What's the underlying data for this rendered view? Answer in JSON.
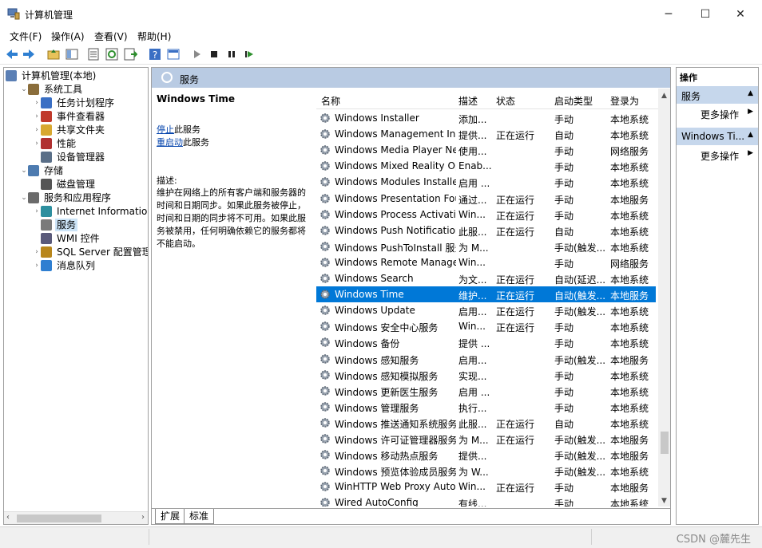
{
  "window": {
    "title": "计算机管理",
    "minimize": "─",
    "maximize": "☐",
    "close": "✕"
  },
  "menu": [
    "文件(F)",
    "操作(A)",
    "查看(V)",
    "帮助(H)"
  ],
  "tree": [
    {
      "label": "计算机管理(本地)",
      "icon": "computer-icon",
      "level": 0,
      "arrow": ""
    },
    {
      "label": "系统工具",
      "icon": "tools-icon",
      "level": 1,
      "arrow": "⌄"
    },
    {
      "label": "任务计划程序",
      "icon": "clock-icon",
      "level": 2,
      "arrow": "›"
    },
    {
      "label": "事件查看器",
      "icon": "event-viewer-icon",
      "level": 2,
      "arrow": "›"
    },
    {
      "label": "共享文件夹",
      "icon": "shared-folder-icon",
      "level": 2,
      "arrow": "›"
    },
    {
      "label": "性能",
      "icon": "performance-icon",
      "level": 2,
      "arrow": "›"
    },
    {
      "label": "设备管理器",
      "icon": "device-manager-icon",
      "level": 2,
      "arrow": ""
    },
    {
      "label": "存储",
      "icon": "storage-icon",
      "level": 1,
      "arrow": "⌄"
    },
    {
      "label": "磁盘管理",
      "icon": "disk-icon",
      "level": 2,
      "arrow": ""
    },
    {
      "label": "服务和应用程序",
      "icon": "services-apps-icon",
      "level": 1,
      "arrow": "⌄"
    },
    {
      "label": "Internet Information Se",
      "icon": "iis-icon",
      "level": 2,
      "arrow": "›"
    },
    {
      "label": "服务",
      "icon": "services-icon",
      "level": 2,
      "arrow": "",
      "selected": true
    },
    {
      "label": "WMI 控件",
      "icon": "wmi-icon",
      "level": 2,
      "arrow": ""
    },
    {
      "label": "SQL Server 配置管理器",
      "icon": "sql-icon",
      "level": 2,
      "arrow": "›"
    },
    {
      "label": "消息队列",
      "icon": "queue-icon",
      "level": 2,
      "arrow": "›"
    }
  ],
  "center": {
    "header": "服务",
    "selected_service": "Windows Time",
    "stop_link": "停止",
    "stop_suffix": "此服务",
    "restart_link": "重启动",
    "restart_suffix": "此服务",
    "desc_label": "描述:",
    "desc_text": "维护在网络上的所有客户端和服务器的时间和日期同步。如果此服务被停止，时间和日期的同步将不可用。如果此服务被禁用，任何明确依赖它的服务都将不能启动。"
  },
  "columns": {
    "name": "名称",
    "desc": "描述",
    "status": "状态",
    "startup": "启动类型",
    "logon": "登录为"
  },
  "services": [
    {
      "name": "Windows Installer",
      "desc": "添加...",
      "status": "",
      "startup": "手动",
      "logon": "本地系统"
    },
    {
      "name": "Windows Management Ins...",
      "desc": "提供...",
      "status": "正在运行",
      "startup": "自动",
      "logon": "本地系统"
    },
    {
      "name": "Windows Media Player Net...",
      "desc": "使用...",
      "status": "",
      "startup": "手动",
      "logon": "网络服务"
    },
    {
      "name": "Windows Mixed Reality Op...",
      "desc": "Enab...",
      "status": "",
      "startup": "手动",
      "logon": "本地系统"
    },
    {
      "name": "Windows Modules Installer",
      "desc": "启用 ...",
      "status": "",
      "startup": "手动",
      "logon": "本地系统"
    },
    {
      "name": "Windows Presentation Fou...",
      "desc": "通过...",
      "status": "正在运行",
      "startup": "手动",
      "logon": "本地服务"
    },
    {
      "name": "Windows Process Activatio...",
      "desc": "Win...",
      "status": "正在运行",
      "startup": "手动",
      "logon": "本地系统"
    },
    {
      "name": "Windows Push Notification...",
      "desc": "此服...",
      "status": "正在运行",
      "startup": "自动",
      "logon": "本地系统"
    },
    {
      "name": "Windows PushToInstall 服务",
      "desc": "为 M...",
      "status": "",
      "startup": "手动(触发...",
      "logon": "本地系统"
    },
    {
      "name": "Windows Remote Manage...",
      "desc": "Win...",
      "status": "",
      "startup": "手动",
      "logon": "网络服务"
    },
    {
      "name": "Windows Search",
      "desc": "为文...",
      "status": "正在运行",
      "startup": "自动(延迟...",
      "logon": "本地系统"
    },
    {
      "name": "Windows Time",
      "desc": "维护...",
      "status": "正在运行",
      "startup": "自动(触发...",
      "logon": "本地服务",
      "selected": true
    },
    {
      "name": "Windows Update",
      "desc": "启用...",
      "status": "正在运行",
      "startup": "手动(触发...",
      "logon": "本地系统"
    },
    {
      "name": "Windows 安全中心服务",
      "desc": "Win...",
      "status": "正在运行",
      "startup": "手动",
      "logon": "本地系统"
    },
    {
      "name": "Windows 备份",
      "desc": "提供 ...",
      "status": "",
      "startup": "手动",
      "logon": "本地系统"
    },
    {
      "name": "Windows 感知服务",
      "desc": "启用...",
      "status": "",
      "startup": "手动(触发...",
      "logon": "本地服务"
    },
    {
      "name": "Windows 感知模拟服务",
      "desc": "实现...",
      "status": "",
      "startup": "手动",
      "logon": "本地系统"
    },
    {
      "name": "Windows 更新医生服务",
      "desc": "启用 ...",
      "status": "",
      "startup": "手动",
      "logon": "本地系统"
    },
    {
      "name": "Windows 管理服务",
      "desc": "执行...",
      "status": "",
      "startup": "手动",
      "logon": "本地系统"
    },
    {
      "name": "Windows 推送通知系统服务",
      "desc": "此服...",
      "status": "正在运行",
      "startup": "自动",
      "logon": "本地系统"
    },
    {
      "name": "Windows 许可证管理器服务",
      "desc": "为 M...",
      "status": "正在运行",
      "startup": "手动(触发...",
      "logon": "本地服务"
    },
    {
      "name": "Windows 移动热点服务",
      "desc": "提供...",
      "status": "",
      "startup": "手动(触发...",
      "logon": "本地服务"
    },
    {
      "name": "Windows 预览体验成员服务",
      "desc": "为 W...",
      "status": "",
      "startup": "手动(触发...",
      "logon": "本地系统"
    },
    {
      "name": "WinHTTP Web Proxy Auto...",
      "desc": "Win...",
      "status": "正在运行",
      "startup": "手动",
      "logon": "本地服务"
    },
    {
      "name": "Wired AutoConfig",
      "desc": "有线...",
      "status": "",
      "startup": "手动",
      "logon": "本地系统"
    }
  ],
  "tabs": [
    "扩展",
    "标准"
  ],
  "actions": {
    "title": "操作",
    "sections": [
      {
        "title": "服务",
        "more": "更多操作"
      },
      {
        "title": "Windows Ti...",
        "more": "更多操作"
      }
    ]
  },
  "watermark": "CSDN @麓先生",
  "colors": {
    "selection": "#0078d7",
    "header": "#b9cbe3",
    "action_section": "#c6d7ec"
  }
}
